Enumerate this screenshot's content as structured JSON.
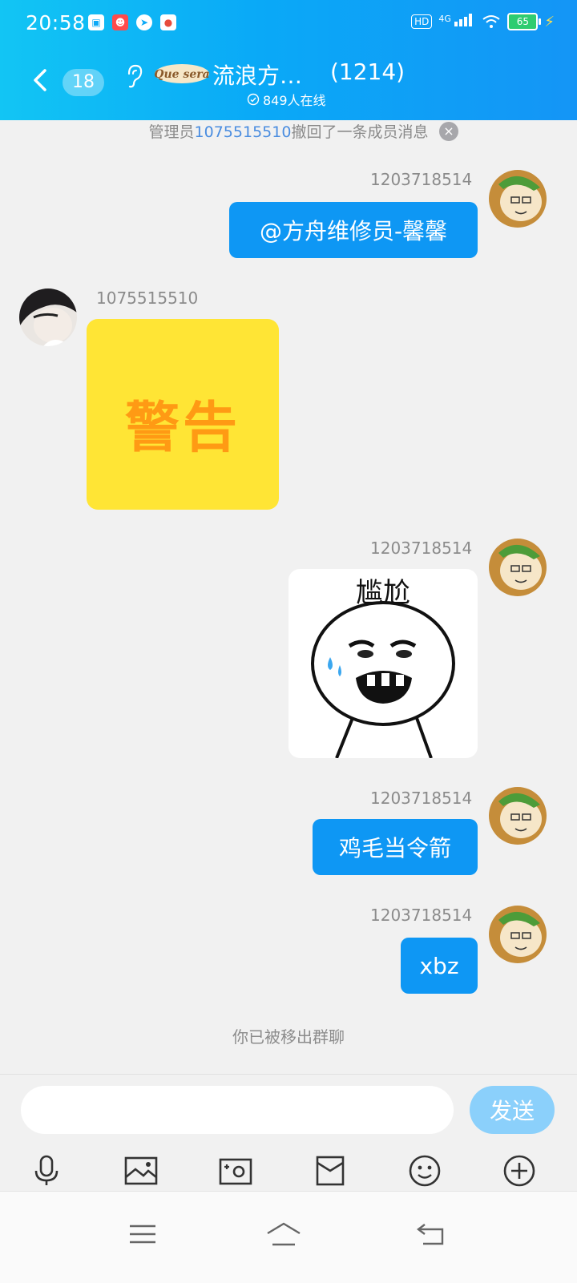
{
  "status_bar": {
    "time": "20:58",
    "network": "4G",
    "battery": "65",
    "hd_label": "HD"
  },
  "header": {
    "unread_count": "18",
    "group_name": "流浪方…",
    "member_count": "(1214)",
    "online_text": "849人在线",
    "logo_text": "Que sera"
  },
  "notice": {
    "prefix": "管理员",
    "uid": "1075515510",
    "suffix": "撤回了一条成员消息",
    "close": "×"
  },
  "messages": [
    {
      "sender": "1203718514",
      "text": "@方舟维修员-馨馨"
    },
    {
      "sender": "1075515510",
      "sticker_text": "警告"
    },
    {
      "sender": "1203718514",
      "sticker_text": "尴尬"
    },
    {
      "sender": "1203718514",
      "text": "鸡毛当令箭"
    },
    {
      "sender": "1203718514",
      "text": "xbz"
    }
  ],
  "system_message": "你已被移出群聊",
  "input": {
    "value": "",
    "send_label": "发送"
  },
  "toolbar_icons": [
    "microphone-icon",
    "image-icon",
    "camera-icon",
    "red-packet-icon",
    "emoji-icon",
    "plus-icon"
  ],
  "nav_icons": [
    "menu-icon",
    "home-icon",
    "back-icon"
  ],
  "colors": {
    "header_start": "#12c5f4",
    "header_end": "#1495f6",
    "bubble": "#0e97f4",
    "sticker_yellow": "#ffe535",
    "warning_orange": "#ff9a14"
  }
}
